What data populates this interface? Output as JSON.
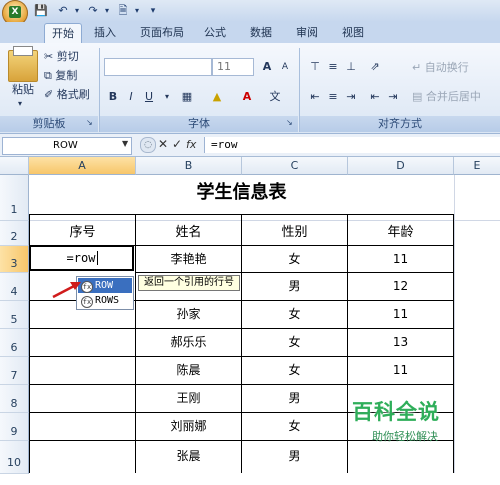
{
  "quick_access": {
    "icons": [
      "save-icon",
      "undo-icon",
      "redo-icon",
      "print-preview-icon",
      "customize-icon"
    ]
  },
  "tabs": [
    "开始",
    "插入",
    "页面布局",
    "公式",
    "数据",
    "审阅",
    "视图"
  ],
  "active_tab": "开始",
  "clipboard": {
    "paste": "粘贴",
    "cut": "剪切",
    "copy": "复制",
    "format_painter": "格式刷",
    "group": "剪贴板"
  },
  "font": {
    "name": "",
    "size": "11",
    "group": "字体",
    "bold": "B",
    "italic": "I",
    "underline": "U",
    "grow": "A",
    "shrink": "A",
    "font_color": "A",
    "wen": "文"
  },
  "alignment": {
    "wrap": "自动换行",
    "merge": "合并后居中",
    "group": "对齐方式"
  },
  "formula_bar": {
    "name_box": "ROW",
    "fx": "fx",
    "formula": "=row"
  },
  "columns": [
    "A",
    "B",
    "C",
    "D",
    "E"
  ],
  "rows": [
    "1",
    "2",
    "3",
    "4",
    "5",
    "6",
    "7",
    "8",
    "9",
    "10"
  ],
  "sheet": {
    "title": "学生信息表",
    "headers": [
      "序号",
      "姓名",
      "性别",
      "年龄"
    ],
    "active_cell_text": "=row",
    "records": [
      {
        "name": "李艳艳",
        "gender": "女",
        "age": "11"
      },
      {
        "name": "",
        "gender": "男",
        "age": "12"
      },
      {
        "name": "孙家",
        "gender": "女",
        "age": "11"
      },
      {
        "name": "郝乐乐",
        "gender": "女",
        "age": "13"
      },
      {
        "name": "陈晨",
        "gender": "女",
        "age": "11"
      },
      {
        "name": "王刚",
        "gender": "男",
        "age": ""
      },
      {
        "name": "刘丽娜",
        "gender": "女",
        "age": ""
      },
      {
        "name": "张晨",
        "gender": "男",
        "age": ""
      }
    ]
  },
  "autocomplete": {
    "items": [
      "ROW",
      "ROWS"
    ],
    "tooltip": "返回一个引用的行号"
  },
  "watermark": {
    "title": "百科全说",
    "subtitle": "助你轻松解决"
  },
  "colors": {
    "accent": "#3a6fbf",
    "selected_col": "#f7c66a",
    "watermark": "#2fae5a"
  }
}
